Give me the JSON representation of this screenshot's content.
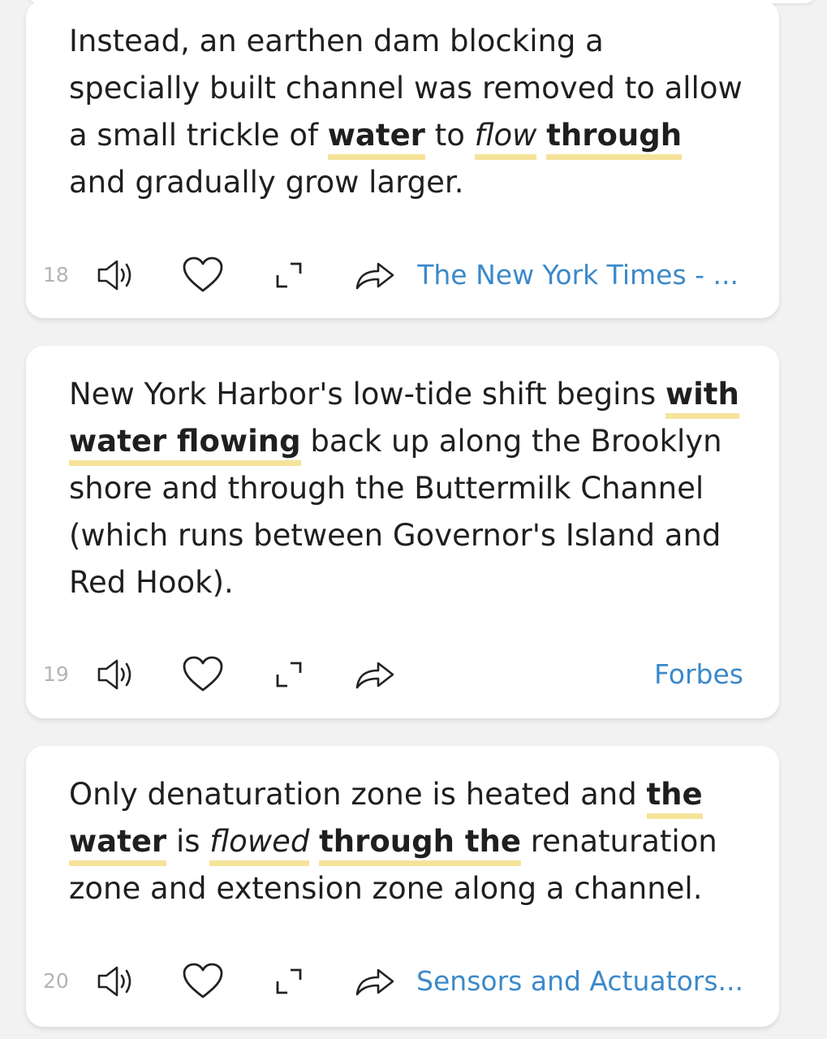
{
  "cards": [
    {
      "number": "18",
      "segments": [
        {
          "t": "Instead, an earthen dam blocking a specially built channel was removed to allow a small trickle of ",
          "s": ""
        },
        {
          "t": "water",
          "s": "hl"
        },
        {
          "t": " to ",
          "s": ""
        },
        {
          "t": "flow",
          "s": "hi"
        },
        {
          "t": " ",
          "s": ""
        },
        {
          "t": "through",
          "s": "hl"
        },
        {
          "t": " and gradually grow larger.",
          "s": ""
        }
      ],
      "source": "The New York Times - ..."
    },
    {
      "number": "19",
      "segments": [
        {
          "t": "New York Harbor's low-tide shift begins ",
          "s": ""
        },
        {
          "t": "with water flowing",
          "s": "hl"
        },
        {
          "t": " back up along the Brooklyn shore and through the Buttermilk Channel (which runs between Governor's Island and Red Hook).",
          "s": ""
        }
      ],
      "source": "Forbes"
    },
    {
      "number": "20",
      "segments": [
        {
          "t": "Only denaturation zone is heated and ",
          "s": ""
        },
        {
          "t": "the water",
          "s": "hl"
        },
        {
          "t": " is ",
          "s": ""
        },
        {
          "t": "flowed",
          "s": "hi"
        },
        {
          "t": " ",
          "s": ""
        },
        {
          "t": "through the",
          "s": "hl"
        },
        {
          "t": " renaturation zone and extension zone along a channel.",
          "s": ""
        }
      ],
      "source": "Sensors and Actuators..."
    }
  ],
  "icons": {
    "listen": "speaker-icon",
    "like": "heart-icon",
    "expand": "expand-icon",
    "share": "share-icon"
  },
  "colors": {
    "highlight": "#f6e39a",
    "source_link": "#3c89c9",
    "index_number": "#b4b4b4"
  }
}
